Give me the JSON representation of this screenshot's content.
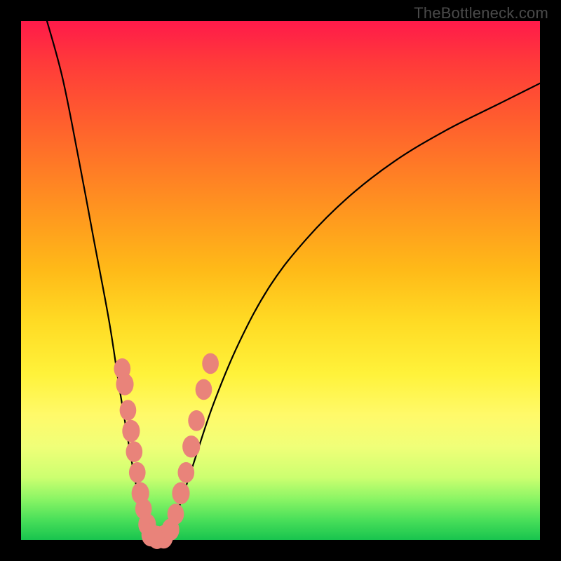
{
  "source_label": "TheBottleneck.com",
  "colors": {
    "frame": "#000000",
    "curve": "#000000",
    "marker": "#e9837a"
  },
  "chart_data": {
    "type": "line",
    "title": "",
    "xlabel": "",
    "ylabel": "",
    "xlim": [
      0,
      100
    ],
    "ylim": [
      0,
      100
    ],
    "note": "x and y in percent of plot area; y measured from bottom (0) to top (100). Two monotone curves meeting near the bottom forming a V shape with scattered markers near the trough.",
    "series": [
      {
        "name": "left-branch",
        "x": [
          5,
          8,
          11,
          14,
          17,
          19,
          21,
          22.5,
          24,
          25
        ],
        "y": [
          100,
          89,
          74,
          58,
          42,
          29,
          17,
          9,
          3,
          0
        ]
      },
      {
        "name": "right-branch",
        "x": [
          28,
          30,
          33,
          37,
          42,
          48,
          55,
          63,
          72,
          82,
          92,
          100
        ],
        "y": [
          0,
          5,
          14,
          26,
          38,
          49,
          58,
          66,
          73,
          79,
          84,
          88
        ]
      }
    ],
    "markers": [
      {
        "x": 19.5,
        "y": 33,
        "r": 1.6
      },
      {
        "x": 20.0,
        "y": 30,
        "r": 1.7
      },
      {
        "x": 20.6,
        "y": 25,
        "r": 1.6
      },
      {
        "x": 21.2,
        "y": 21,
        "r": 1.7
      },
      {
        "x": 21.8,
        "y": 17,
        "r": 1.6
      },
      {
        "x": 22.4,
        "y": 13,
        "r": 1.6
      },
      {
        "x": 23.0,
        "y": 9,
        "r": 1.7
      },
      {
        "x": 23.6,
        "y": 6,
        "r": 1.6
      },
      {
        "x": 24.3,
        "y": 3,
        "r": 1.7
      },
      {
        "x": 25.0,
        "y": 1,
        "r": 1.8
      },
      {
        "x": 26.2,
        "y": 0.5,
        "r": 1.8
      },
      {
        "x": 27.5,
        "y": 0.6,
        "r": 1.8
      },
      {
        "x": 28.8,
        "y": 2,
        "r": 1.7
      },
      {
        "x": 29.8,
        "y": 5,
        "r": 1.6
      },
      {
        "x": 30.8,
        "y": 9,
        "r": 1.7
      },
      {
        "x": 31.8,
        "y": 13,
        "r": 1.6
      },
      {
        "x": 32.8,
        "y": 18,
        "r": 1.7
      },
      {
        "x": 33.8,
        "y": 23,
        "r": 1.6
      },
      {
        "x": 35.2,
        "y": 29,
        "r": 1.6
      },
      {
        "x": 36.5,
        "y": 34,
        "r": 1.6
      }
    ]
  }
}
